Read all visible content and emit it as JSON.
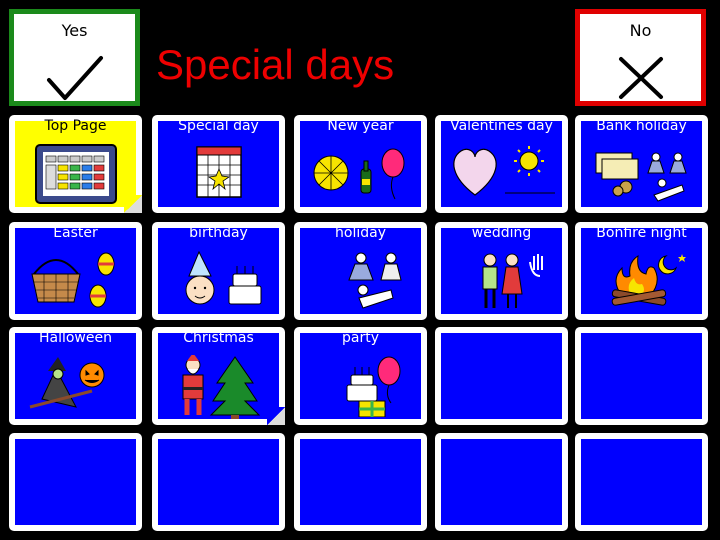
{
  "header": {
    "title": "Special days",
    "yes_label": "Yes",
    "no_label": "No"
  },
  "grid": {
    "cells": [
      {
        "label": "Top Page",
        "icon": "grid-icon",
        "style": "yellow"
      },
      {
        "label": "Special day",
        "icon": "calendar-icon"
      },
      {
        "label": "New year",
        "icon": "fireworks-icon"
      },
      {
        "label": "Valentines day",
        "icon": "heart-sun-icon"
      },
      {
        "label": "Bank holiday",
        "icon": "money-leisure-icon"
      },
      {
        "label": "Easter",
        "icon": "easter-eggs-icon"
      },
      {
        "label": "birthday",
        "icon": "birthday-cake-icon"
      },
      {
        "label": "holiday",
        "icon": "holiday-people-icon"
      },
      {
        "label": "wedding",
        "icon": "wedding-couple-icon"
      },
      {
        "label": "Bonfire night",
        "icon": "bonfire-icon"
      },
      {
        "label": "Halloween",
        "icon": "witch-pumpkin-icon"
      },
      {
        "label": "Christmas",
        "icon": "santa-tree-icon"
      },
      {
        "label": "party",
        "icon": "party-cake-balloon-icon"
      },
      {
        "label": ""
      },
      {
        "label": ""
      },
      {
        "label": ""
      },
      {
        "label": ""
      },
      {
        "label": ""
      },
      {
        "label": ""
      },
      {
        "label": ""
      }
    ]
  }
}
